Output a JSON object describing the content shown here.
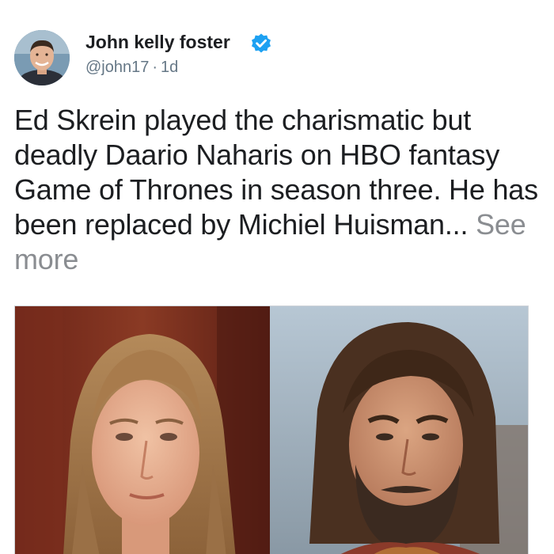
{
  "tweet": {
    "author": {
      "display_name": "John kelly foster",
      "handle": "@john17",
      "separator": "·",
      "time_ago": "1d",
      "verified": true,
      "verified_color": "#1da1f2"
    },
    "text": "Ed Skrein played the charismatic but deadly Daario Naharis on HBO fantasy Game of Thrones in season three. He has been replaced by Michiel Huisman...",
    "see_more_label": "See more",
    "media": {
      "images": [
        {
          "icon": "photo-long-haired-man"
        },
        {
          "icon": "photo-bearded-man"
        }
      ]
    }
  }
}
